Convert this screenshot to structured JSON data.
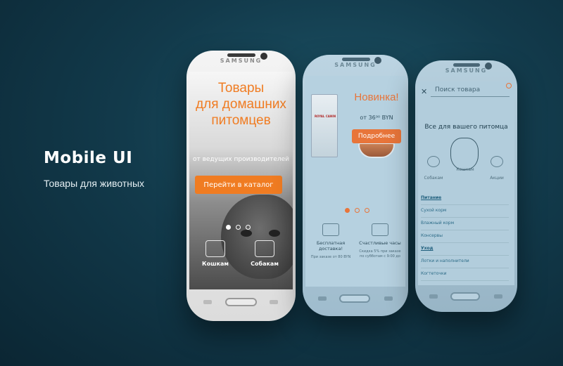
{
  "hero": {
    "title": "Mobile UI",
    "subtitle": "Товары для животных"
  },
  "brand": "SAMSUNG",
  "phone1": {
    "title_lines": [
      "Товары",
      "для домашних",
      "питомцев"
    ],
    "subtitle": "от ведущих производителей",
    "cta": "Перейти в каталог",
    "slider": {
      "count": 3,
      "active": 1
    },
    "categories": [
      {
        "label": "Кошкам",
        "icon": "cat-food-icon"
      },
      {
        "label": "Собакам",
        "icon": "dog-food-icon"
      }
    ]
  },
  "phone2": {
    "new_label": "Новинка!",
    "price": "от 36⁹⁰ BYN",
    "cta": "Подробнее",
    "product_brand": "ROYAL CANIN",
    "slider": {
      "count": 3,
      "active": 1
    },
    "features": [
      {
        "title": "Бесплатная доставка!",
        "text": "При заказе от 80 BYN",
        "icon": "delivery-truck-icon"
      },
      {
        "title": "Счастливые часы",
        "text": "Скидка 5% при заказе по субботам с 9:00 до",
        "icon": "discount-tag-icon"
      }
    ]
  },
  "phone3": {
    "search_placeholder": "Поиск товара",
    "heading": "Все для вашего питомца",
    "side_options": [
      {
        "label": "Собакам",
        "icon": "dog-icon"
      },
      {
        "label": "Кошкам",
        "icon": "cat-icon"
      },
      {
        "label": "Акции",
        "icon": "sale-icon"
      }
    ],
    "menu": [
      {
        "label": "Питание",
        "group": true
      },
      {
        "label": "Сухой корм",
        "group": false
      },
      {
        "label": "Влажный корм",
        "group": false
      },
      {
        "label": "Консервы",
        "group": false
      },
      {
        "label": "Уход",
        "group": true
      },
      {
        "label": "Лотки и наполнители",
        "group": false
      },
      {
        "label": "Когтеточки",
        "group": false
      }
    ]
  },
  "colors": {
    "accent": "#f07c22",
    "background": "#123a4b"
  }
}
